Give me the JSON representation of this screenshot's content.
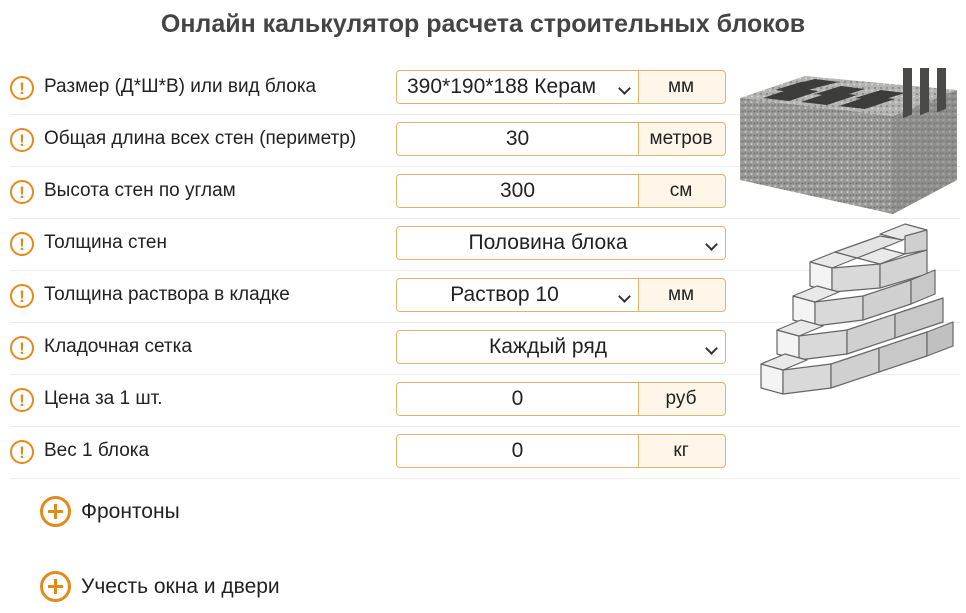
{
  "page": {
    "title": "Онлайн калькулятор расчета строительных блоков"
  },
  "rows": [
    {
      "label": "Размер (Д*Ш*В) или вид блока",
      "value": "390*190*188 Керам",
      "unit": "мм"
    },
    {
      "label": "Общая длина всех стен (периметр)",
      "value": "30",
      "unit": "метров"
    },
    {
      "label": "Высота стен по углам",
      "value": "300",
      "unit": "см"
    },
    {
      "label": "Толщина стен",
      "value": "Половина блока"
    },
    {
      "label": "Толщина раствора в кладке",
      "value": "Раствор 10",
      "unit": "мм"
    },
    {
      "label": "Кладочная сетка",
      "value": "Каждый ряд"
    },
    {
      "label": "Цена за 1 шт.",
      "value": "0",
      "unit": "руб"
    },
    {
      "label": "Вес 1 блока",
      "value": "0",
      "unit": "кг"
    }
  ],
  "hint_glyph": "!",
  "extras": [
    {
      "label": "Фронтоны"
    },
    {
      "label": "Учесть окна и двери"
    }
  ],
  "icons": {
    "hint": "exclamation-circle-icon",
    "expand": "plus-circle-icon",
    "dropdown": "chevron-down-icon"
  },
  "colors": {
    "accent": "#e38a1c",
    "field_border": "#e0b46c",
    "unit_bg": "#fdf6e9"
  }
}
